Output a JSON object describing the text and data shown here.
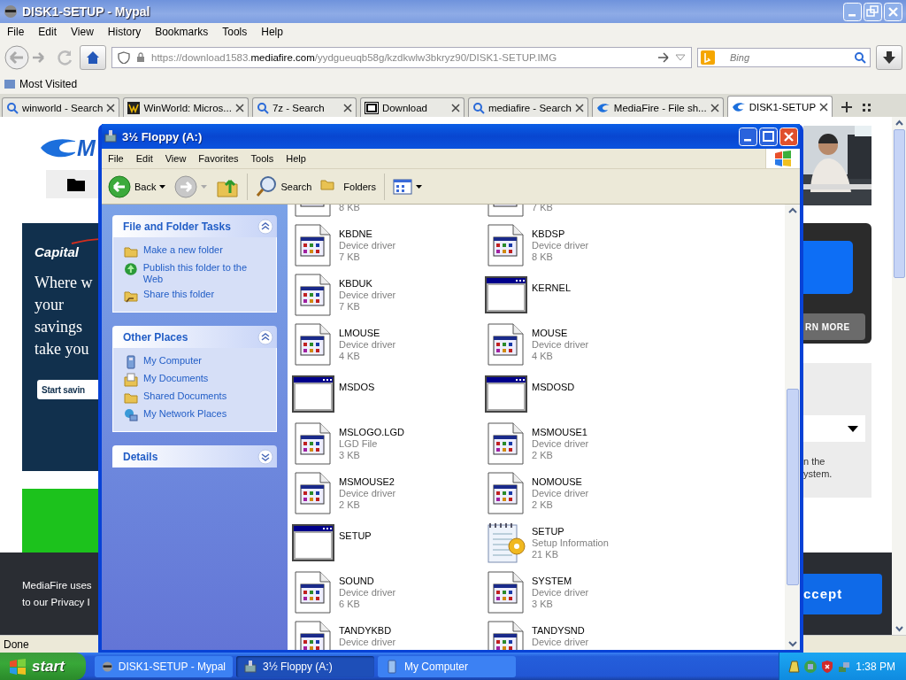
{
  "browser": {
    "title": "DISK1-SETUP - Mypal",
    "menu": [
      "File",
      "Edit",
      "View",
      "History",
      "Bookmarks",
      "Tools",
      "Help"
    ],
    "url": "https://download1583.**mediafire.com**/yydgueuqb58g/kzdkwlw3bkryz90/DISK1-SETUP.IMG",
    "search": {
      "placeholder": "Bing"
    },
    "bookmarks": [
      "Most Visited"
    ],
    "tabs": [
      {
        "label": "winworld - Search",
        "kind": "search",
        "selected": false
      },
      {
        "label": "WinWorld: Micros...",
        "kind": "site",
        "selected": false
      },
      {
        "label": "7z - Search",
        "kind": "search",
        "selected": false
      },
      {
        "label": "Download",
        "kind": "archive",
        "selected": false
      },
      {
        "label": "mediafire - Search",
        "kind": "search",
        "selected": false
      },
      {
        "label": "MediaFire - File sh...",
        "kind": "flame",
        "selected": false
      },
      {
        "label": "DISK1-SETUP",
        "kind": "flame",
        "selected": true
      }
    ],
    "status": "Done"
  },
  "webpage": {
    "logo": "M",
    "ad_left": {
      "logo": "Capital",
      "headline": [
        "Where w",
        "your",
        "savings",
        "take you"
      ],
      "button": "Start savin"
    },
    "ad_right": {
      "button": "RN MORE"
    },
    "panel_right": [
      "n the",
      "ystem."
    ],
    "cookie_banner": {
      "lines": [
        "MediaFire uses",
        "to our Privacy I"
      ],
      "button": "ccept"
    }
  },
  "explorer": {
    "title": "3½ Floppy (A:)",
    "menu": [
      "File",
      "Edit",
      "View",
      "Favorites",
      "Tools",
      "Help"
    ],
    "toolbar": [
      {
        "kind": "back",
        "label": "Back"
      },
      {
        "kind": "forward"
      },
      {
        "kind": "up"
      },
      {
        "kind": "search",
        "label": "Search"
      },
      {
        "kind": "folders",
        "label": "Folders"
      },
      {
        "kind": "views"
      }
    ],
    "task_panels": [
      {
        "title": "File and Folder Tasks",
        "expanded": true,
        "items": [
          {
            "label": "Make a new folder",
            "kind": "new-folder"
          },
          {
            "label": "Publish this folder to the Web",
            "kind": "globe"
          },
          {
            "label": "Share this folder",
            "kind": "share"
          }
        ]
      },
      {
        "title": "Other Places",
        "expanded": true,
        "items": [
          {
            "label": "My Computer",
            "kind": "computer"
          },
          {
            "label": "My Documents",
            "kind": "documents"
          },
          {
            "label": "Shared Documents",
            "kind": "folder"
          },
          {
            "label": "My Network Places",
            "kind": "network"
          }
        ]
      },
      {
        "title": "Details",
        "expanded": false
      }
    ],
    "files": [
      {
        "kind": "driver",
        "size": "8 KB"
      },
      {
        "kind": "driver",
        "size": "7 KB"
      },
      {
        "kind": "driver",
        "name": "KBDNE",
        "type": "Device driver",
        "size": "7 KB"
      },
      {
        "kind": "driver",
        "name": "KBDSP",
        "type": "Device driver",
        "size": "8 KB"
      },
      {
        "kind": "driver",
        "name": "KBDUK",
        "type": "Device driver",
        "size": "7 KB"
      },
      {
        "kind": "app",
        "name": "KERNEL"
      },
      {
        "kind": "driver",
        "name": "LMOUSE",
        "type": "Device driver",
        "size": "4 KB"
      },
      {
        "kind": "driver",
        "name": "MOUSE",
        "type": "Device driver",
        "size": "4 KB"
      },
      {
        "kind": "app",
        "name": "MSDOS"
      },
      {
        "kind": "app",
        "name": "MSDOSD"
      },
      {
        "kind": "driver",
        "name": "MSLOGO.LGD",
        "type": "LGD File",
        "size": "3 KB"
      },
      {
        "kind": "driver",
        "name": "MSMOUSE1",
        "type": "Device driver",
        "size": "2 KB"
      },
      {
        "kind": "driver",
        "name": "MSMOUSE2",
        "type": "Device driver",
        "size": "2 KB"
      },
      {
        "kind": "driver",
        "name": "NOMOUSE",
        "type": "Device driver",
        "size": "2 KB"
      },
      {
        "kind": "app",
        "name": "SETUP"
      },
      {
        "kind": "setup",
        "name": "SETUP",
        "type": "Setup Information",
        "size": "21 KB"
      },
      {
        "kind": "driver",
        "name": "SOUND",
        "type": "Device driver",
        "size": "6 KB"
      },
      {
        "kind": "driver",
        "name": "SYSTEM",
        "type": "Device driver",
        "size": "3 KB"
      },
      {
        "kind": "driver",
        "name": "TANDYKBD",
        "type": "Device driver"
      },
      {
        "kind": "driver",
        "name": "TANDYSND",
        "type": "Device driver"
      }
    ]
  },
  "taskbar": {
    "start": "start",
    "items": [
      {
        "label": "DISK1-SETUP - Mypal",
        "kind": "browser",
        "selected": false
      },
      {
        "label": "3½ Floppy (A:)",
        "kind": "drive",
        "selected": true
      },
      {
        "label": "My Computer",
        "kind": "computer",
        "selected": false
      }
    ],
    "clock": "1:38 PM"
  }
}
